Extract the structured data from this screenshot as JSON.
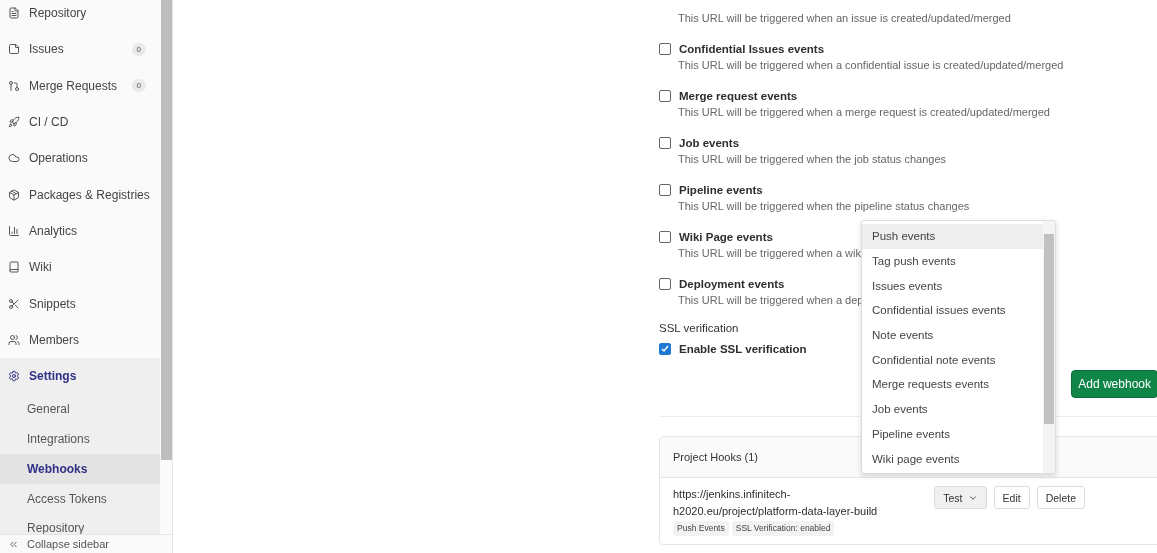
{
  "sidebar": {
    "items": [
      {
        "label": "Repository",
        "selected": false
      },
      {
        "label": "Issues",
        "count": "0",
        "selected": false
      },
      {
        "label": "Merge Requests",
        "count": "0",
        "selected": false
      },
      {
        "label": "CI / CD",
        "selected": false
      },
      {
        "label": "Operations",
        "selected": false
      },
      {
        "label": "Packages & Registries",
        "selected": false
      },
      {
        "label": "Analytics",
        "selected": false
      },
      {
        "label": "Wiki",
        "selected": false
      },
      {
        "label": "Snippets",
        "selected": false
      },
      {
        "label": "Members",
        "selected": false
      },
      {
        "label": "Settings",
        "selected": true,
        "expanded": true,
        "children": [
          {
            "label": "General",
            "selected": false
          },
          {
            "label": "Integrations",
            "selected": false
          },
          {
            "label": "Webhooks",
            "selected": true
          },
          {
            "label": "Access Tokens",
            "selected": false
          },
          {
            "label": "Repository",
            "selected": false
          }
        ]
      }
    ],
    "collapse": "Collapse sidebar"
  },
  "triggers": {
    "top_description": "This URL will be triggered when an issue is created/updated/merged",
    "items": [
      {
        "title": "Confidential Issues events",
        "description": "This URL will be triggered when a confidential issue is created/updated/merged",
        "checked": false
      },
      {
        "title": "Merge request events",
        "description": "This URL will be triggered when a merge request is created/updated/merged",
        "checked": false
      },
      {
        "title": "Job events",
        "description": "This URL will be triggered when the job status changes",
        "checked": false
      },
      {
        "title": "Pipeline events",
        "description": "This URL will be triggered when the pipeline status changes",
        "checked": false
      },
      {
        "title": "Wiki Page events",
        "description": "This URL will be triggered when a wik",
        "checked": false
      },
      {
        "title": "Deployment events",
        "description": "This URL will be triggered when a dep",
        "checked": false
      }
    ]
  },
  "ssl": {
    "heading": "SSL verification",
    "label": "Enable SSL verification",
    "checked": true
  },
  "add_button": "Add webhook",
  "dropdown": {
    "options": [
      {
        "label": "Push events",
        "selected": true
      },
      {
        "label": "Tag push events",
        "selected": false
      },
      {
        "label": "Issues events",
        "selected": false
      },
      {
        "label": "Confidential issues events",
        "selected": false
      },
      {
        "label": "Note events",
        "selected": false
      },
      {
        "label": "Confidential note events",
        "selected": false
      },
      {
        "label": "Merge requests events",
        "selected": false
      },
      {
        "label": "Job events",
        "selected": false
      },
      {
        "label": "Pipeline events",
        "selected": false
      },
      {
        "label": "Wiki page events",
        "selected": false
      }
    ]
  },
  "hooks": {
    "title": "Project Hooks (1)",
    "items": [
      {
        "url_line_1": "https://jenkins.infinitech-",
        "url_line_2": "h2020.eu/project/platform-data-layer-build",
        "tags": [
          "Push Events",
          "SSL Verification: enabled"
        ],
        "buttons": [
          "Test",
          "Edit",
          "Delete"
        ]
      }
    ]
  }
}
